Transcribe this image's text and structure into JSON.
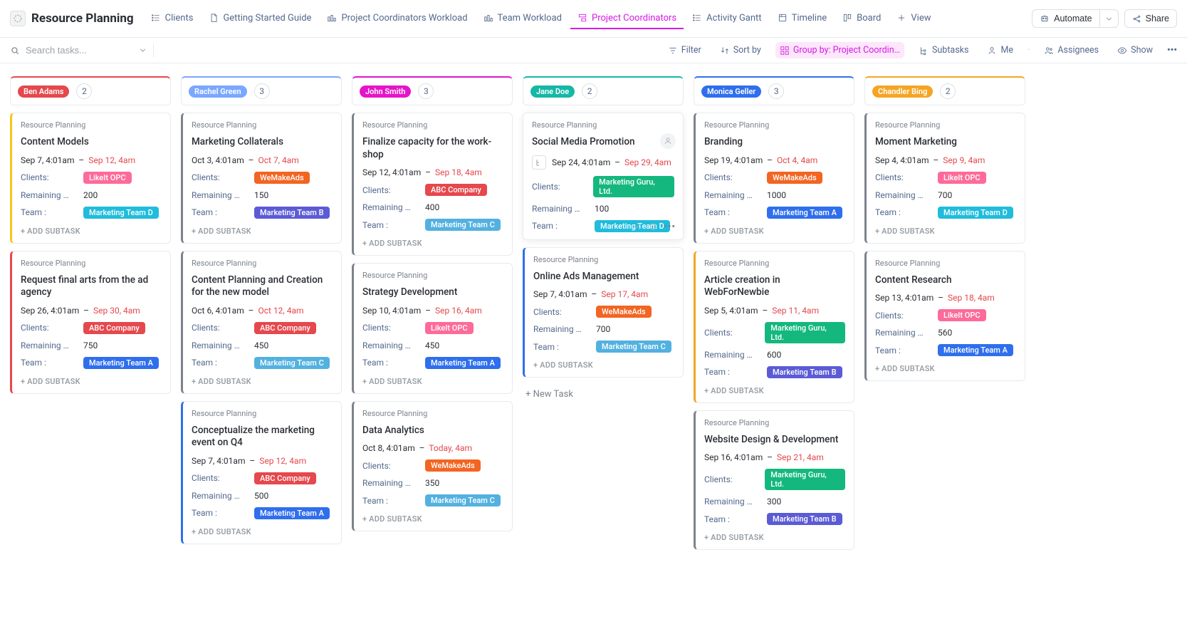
{
  "app": {
    "title": "Resource Planning"
  },
  "tabs": [
    {
      "label": "Clients",
      "icon": "list"
    },
    {
      "label": "Getting Started Guide",
      "icon": "doc"
    },
    {
      "label": "Project Coordinators Workload",
      "icon": "workload"
    },
    {
      "label": "Team Workload",
      "icon": "workload"
    },
    {
      "label": "Project Coordinators",
      "icon": "boardrot",
      "active": true
    },
    {
      "label": "Activity Gantt",
      "icon": "list"
    },
    {
      "label": "Timeline",
      "icon": "timeline"
    },
    {
      "label": "Board",
      "icon": "board"
    },
    {
      "label": "View",
      "icon": "plus"
    }
  ],
  "topbarButtons": {
    "automate": "Automate",
    "share": "Share"
  },
  "search": {
    "placeholder": "Search tasks..."
  },
  "toolbar": {
    "filter": "Filter",
    "sortby": "Sort by",
    "groupby": "Group by: Project Coordin…",
    "subtasks": "Subtasks",
    "me": "Me",
    "assignees": "Assignees",
    "show": "Show"
  },
  "labels": {
    "clients": "Clients:",
    "remaining": "Remaining …",
    "team": "Team :",
    "addSubtask": "+ ADD SUBTASK",
    "newTask": "+ New Task",
    "crumb": "Resource Planning"
  },
  "clientColors": {
    "LikeIt OPC": "#fd6b9a",
    "WeMakeAds": "#f26522",
    "ABC Company": "#e5484d",
    "Marketing Guru, Ltd.": "#14b87e"
  },
  "teamColors": {
    "Marketing Team A": "#2f6fed",
    "Marketing Team B": "#5b5bd6",
    "Marketing Team C": "#53b1e0",
    "Marketing Team D": "#20bcdc"
  },
  "columns": [
    {
      "name": "Ben Adams",
      "color": "#e5484d",
      "count": "2",
      "cards": [
        {
          "title": "Content Models",
          "start": "Sep 7, 4:01am",
          "end": "Sep 12, 4am",
          "client": "LikeIt OPC",
          "remaining": "200",
          "team": "Marketing Team D",
          "stripe": "#f5c518"
        },
        {
          "title": "Request final arts from the ad agency",
          "start": "Sep 26, 4:01am",
          "end": "Sep 30, 4am",
          "client": "ABC Company",
          "remaining": "750",
          "team": "Marketing Team A",
          "stripe": "#e5484d"
        }
      ]
    },
    {
      "name": "Rachel Green",
      "color": "#7aa7ff",
      "count": "3",
      "cards": [
        {
          "title": "Marketing Collaterals",
          "start": "Oct 3, 4:01am",
          "end": "Oct 7, 4am",
          "client": "WeMakeAds",
          "remaining": "150",
          "team": "Marketing Team B",
          "stripe": "#7c828d"
        },
        {
          "title": "Content Planning and Creation for the new model",
          "start": "Oct 6, 4:01am",
          "end": "Oct 12, 4am",
          "client": "ABC Company",
          "remaining": "450",
          "team": "Marketing Team C",
          "stripe": "#7c828d"
        },
        {
          "title": "Conceptualize the marketing event on Q4",
          "start": "Sep 7, 4:01am",
          "end": "Sep 12, 4am",
          "client": "ABC Company",
          "remaining": "500",
          "team": "Marketing Team A",
          "stripe": "#2f6fed"
        }
      ]
    },
    {
      "name": "John Smith",
      "color": "#e614c9",
      "count": "3",
      "cards": [
        {
          "title": "Finalize capacity for the work­shop",
          "start": "Sep 12, 4:01am",
          "end": "Sep 18, 4am",
          "client": "ABC Company",
          "remaining": "400",
          "team": "Marketing Team C",
          "stripe": "#7c828d"
        },
        {
          "title": "Strategy Development",
          "start": "Sep 10, 4:01am",
          "end": "Sep 16, 4am",
          "client": "LikeIt OPC",
          "remaining": "450",
          "team": "Marketing Team A",
          "stripe": "#7c828d"
        },
        {
          "title": "Data Analytics",
          "start": "Oct 8, 4:01am",
          "end": "Today, 4am",
          "client": "WeMakeAds",
          "remaining": "350",
          "team": "Marketing Team C",
          "stripe": "#7c828d"
        }
      ]
    },
    {
      "name": "Jane Doe",
      "color": "#14b8a6",
      "count": "2",
      "cards": [
        {
          "title": "Social Media Promotion",
          "start": "Sep 24, 4:01am",
          "end": "Sep 29, 4am",
          "client": "Marketing Guru, Ltd.",
          "remaining": "100",
          "team": "Marketing Team D",
          "stripe": "#ffffff",
          "hover": true,
          "subtaskIcon": true,
          "avatarGhost": true,
          "bullets": true
        },
        {
          "title": "Online Ads Management",
          "start": "Sep 7, 4:01am",
          "end": "Sep 17, 4am",
          "client": "WeMakeAds",
          "remaining": "700",
          "team": "Marketing Team C",
          "stripe": "#2f6fed"
        }
      ],
      "showNewTask": true
    },
    {
      "name": "Monica Geller",
      "color": "#2f6fed",
      "count": "3",
      "cards": [
        {
          "title": "Branding",
          "start": "Sep 19, 4:01am",
          "end": "Oct 4, 4am",
          "client": "WeMakeAds",
          "remaining": "1000",
          "team": "Marketing Team A",
          "stripe": "#7c828d"
        },
        {
          "title": "Article creation in WebForNewbie",
          "start": "Sep 5, 4:01am",
          "end": "Sep 11, 4am",
          "client": "Marketing Guru, Ltd.",
          "remaining": "600",
          "team": "Marketing Team B",
          "stripe": "#f5a524"
        },
        {
          "title": "Website Design & Development",
          "start": "Sep 16, 4:01am",
          "end": "Sep 21, 4am",
          "client": "Marketing Guru, Ltd.",
          "remaining": "300",
          "team": "Marketing Team B",
          "stripe": "#7c828d"
        }
      ]
    },
    {
      "name": "Chandler Bing",
      "color": "#f5a524",
      "count": "2",
      "cards": [
        {
          "title": "Moment Marketing",
          "start": "Sep 4, 4:01am",
          "end": "Sep 9, 4am",
          "client": "LikeIt OPC",
          "remaining": "700",
          "team": "Marketing Team D",
          "stripe": "#7c828d"
        },
        {
          "title": "Content Research",
          "start": "Sep 13, 4:01am",
          "end": "Sep 18, 4am",
          "client": "LikeIt OPC",
          "remaining": "560",
          "team": "Marketing Team A",
          "stripe": "#7c828d"
        }
      ]
    }
  ]
}
